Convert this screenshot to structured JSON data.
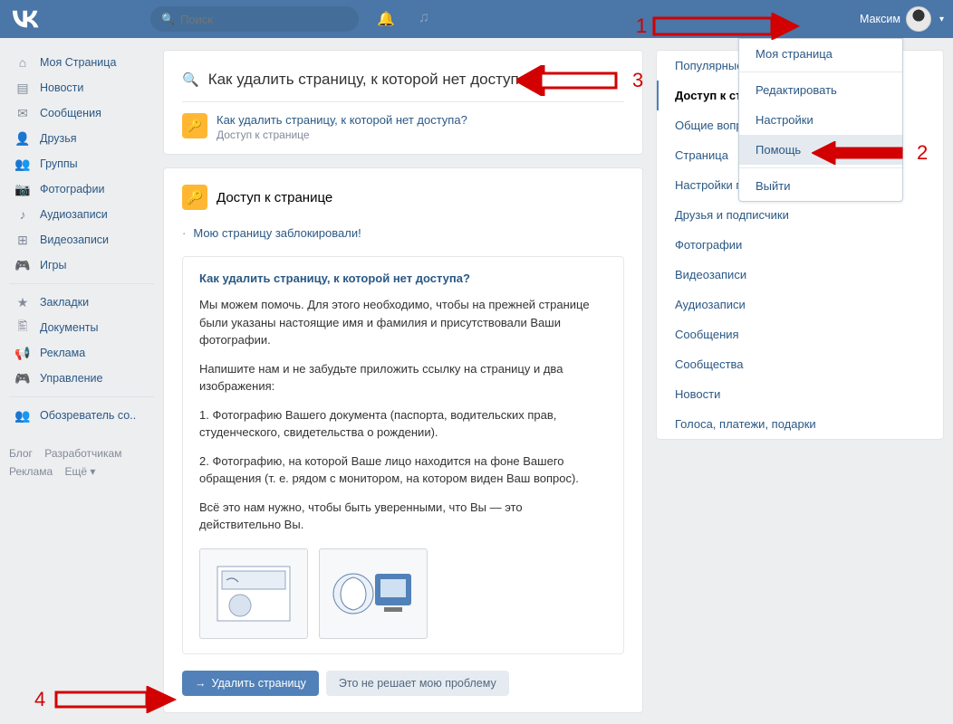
{
  "header": {
    "search_placeholder": "Поиск",
    "username": "Максим"
  },
  "sidebar": {
    "items": [
      "Моя Страница",
      "Новости",
      "Сообщения",
      "Друзья",
      "Группы",
      "Фотографии",
      "Аудиозаписи",
      "Видеозаписи",
      "Игры"
    ],
    "items2": [
      "Закладки",
      "Документы",
      "Реклама",
      "Управление"
    ],
    "items3": [
      "Обозреватель со.."
    ],
    "footer": {
      "blog": "Блог",
      "dev": "Разработчикам",
      "ads": "Реклама",
      "more": "Ещё"
    }
  },
  "dropdown": {
    "items": [
      "Моя страница",
      "Редактировать",
      "Настройки",
      "Помощь",
      "Выйти"
    ],
    "highlight_index": 3
  },
  "big_search": {
    "value": "Как удалить страницу, к которой нет доступа"
  },
  "result": {
    "title": "Как удалить страницу, к которой нет доступа?",
    "sub": "Доступ к странице"
  },
  "content": {
    "heading": "Доступ к странице",
    "link": "Мою страницу заблокировали!",
    "art_title": "Как удалить страницу, к которой нет доступа?",
    "p1": "Мы можем помочь. Для этого необходимо, чтобы на прежней странице были указаны настоящие имя и фамилия и присутствовали Ваши фотографии.",
    "p2": "Напишите нам и не забудьте приложить ссылку на страницу и два изображения:",
    "p3": "1. Фотографию Вашего документа (паспорта, водительских прав, студенческого, свидетельства о рождении).",
    "p4": "2. Фотографию, на которой Ваше лицо находится на фоне Вашего обращения (т. е. рядом с монитором, на котором виден Ваш вопрос).",
    "p5": "Всё это нам нужно, чтобы быть уверенными, что Вы — это действительно Вы.",
    "btn_primary": "Удалить страницу",
    "btn_secondary": "Это не решает мою проблему"
  },
  "tabs": [
    "Популярные",
    "Доступ к странице",
    "Общие вопросы",
    "Страница",
    "Настройки приватности",
    "Друзья и подписчики",
    "Фотографии",
    "Видеозаписи",
    "Аудиозаписи",
    "Сообщения",
    "Сообщества",
    "Новости",
    "Голоса, платежи, подарки"
  ],
  "tabs_active_index": 1,
  "annotations": {
    "n1": "1",
    "n2": "2",
    "n3": "3",
    "n4": "4"
  }
}
